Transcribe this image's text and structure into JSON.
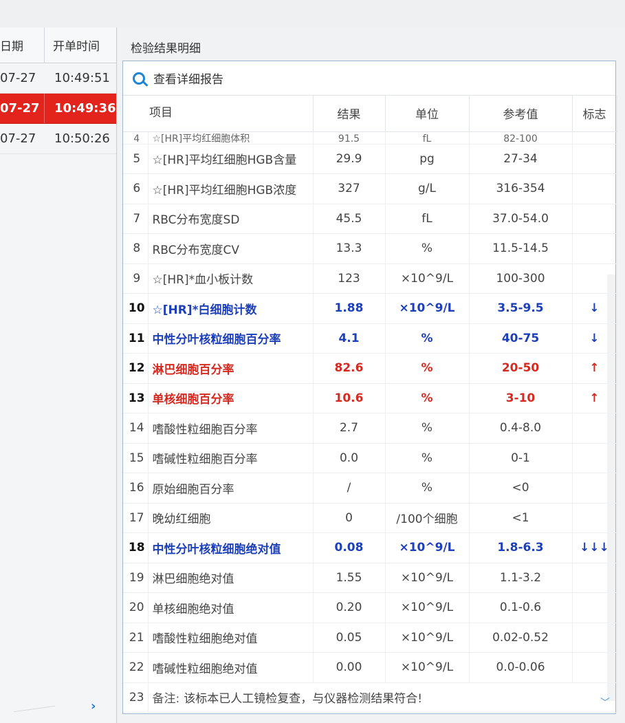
{
  "left_panel": {
    "columns": [
      "日期",
      "开单时间"
    ],
    "rows": [
      {
        "date": "07-27",
        "time": "10:49:51",
        "selected": false
      },
      {
        "date": "07-27",
        "time": "10:49:36",
        "selected": true
      },
      {
        "date": "07-27",
        "time": "10:50:26",
        "selected": false
      }
    ]
  },
  "main_panel": {
    "title": "检验结果明细",
    "toolbar_label": "查看详细报告"
  },
  "table": {
    "headers": {
      "item": "项目",
      "result": "结果",
      "unit": "单位",
      "ref": "参考值",
      "flag": "标志"
    },
    "partial_row": {
      "no": "4",
      "item": "☆[HR]平均红细胞体积",
      "result": "91.5",
      "unit": "fL",
      "ref": "82-100",
      "flag": ""
    },
    "rows": [
      {
        "no": "5",
        "item": "☆[HR]平均红细胞HGB含量",
        "result": "29.9",
        "unit": "pg",
        "ref": "27-34",
        "flag": "",
        "status": "normal"
      },
      {
        "no": "6",
        "item": "☆[HR]平均红细胞HGB浓度",
        "result": "327",
        "unit": "g/L",
        "ref": "316-354",
        "flag": "",
        "status": "normal"
      },
      {
        "no": "7",
        "item": "RBC分布宽度SD",
        "result": "45.5",
        "unit": "fL",
        "ref": "37.0-54.0",
        "flag": "",
        "status": "normal"
      },
      {
        "no": "8",
        "item": "RBC分布宽度CV",
        "result": "13.3",
        "unit": "%",
        "ref": "11.5-14.5",
        "flag": "",
        "status": "normal"
      },
      {
        "no": "9",
        "item": "☆[HR]*血小板计数",
        "result": "123",
        "unit": "×10^9/L",
        "ref": "100-300",
        "flag": "",
        "status": "normal"
      },
      {
        "no": "10",
        "item": "☆[HR]*白细胞计数",
        "result": "1.88",
        "unit": "×10^9/L",
        "ref": "3.5-9.5",
        "flag": "↓",
        "status": "low"
      },
      {
        "no": "11",
        "item": "中性分叶核粒细胞百分率",
        "result": "4.1",
        "unit": "%",
        "ref": "40-75",
        "flag": "↓",
        "status": "low"
      },
      {
        "no": "12",
        "item": "淋巴细胞百分率",
        "result": "82.6",
        "unit": "%",
        "ref": "20-50",
        "flag": "↑",
        "status": "high"
      },
      {
        "no": "13",
        "item": "单核细胞百分率",
        "result": "10.6",
        "unit": "%",
        "ref": "3-10",
        "flag": "↑",
        "status": "high"
      },
      {
        "no": "14",
        "item": "嗜酸性粒细胞百分率",
        "result": "2.7",
        "unit": "%",
        "ref": "0.4-8.0",
        "flag": "",
        "status": "normal"
      },
      {
        "no": "15",
        "item": "嗜碱性粒细胞百分率",
        "result": "0.0",
        "unit": "%",
        "ref": "0-1",
        "flag": "",
        "status": "normal"
      },
      {
        "no": "16",
        "item": "原始细胞百分率",
        "result": "/",
        "unit": "%",
        "ref": "<0",
        "flag": "",
        "status": "normal"
      },
      {
        "no": "17",
        "item": "晚幼红细胞",
        "result": "0",
        "unit": "/100个细胞",
        "ref": "<1",
        "flag": "",
        "status": "normal"
      },
      {
        "no": "18",
        "item": "中性分叶核粒细胞绝对值",
        "result": "0.08",
        "unit": "×10^9/L",
        "ref": "1.8-6.3",
        "flag": "↓↓↓",
        "status": "low"
      },
      {
        "no": "19",
        "item": "淋巴细胞绝对值",
        "result": "1.55",
        "unit": "×10^9/L",
        "ref": "1.1-3.2",
        "flag": "",
        "status": "normal"
      },
      {
        "no": "20",
        "item": "单核细胞绝对值",
        "result": "0.20",
        "unit": "×10^9/L",
        "ref": "0.1-0.6",
        "flag": "",
        "status": "normal"
      },
      {
        "no": "21",
        "item": "嗜酸性粒细胞绝对值",
        "result": "0.05",
        "unit": "×10^9/L",
        "ref": "0.02-0.52",
        "flag": "",
        "status": "normal"
      },
      {
        "no": "22",
        "item": "嗜碱性粒细胞绝对值",
        "result": "0.00",
        "unit": "×10^9/L",
        "ref": "0.0-0.06",
        "flag": "",
        "status": "normal"
      }
    ],
    "remark_row": {
      "no": "23",
      "label": "备注:",
      "text": "该标本已人工镜检复查，与仪器检测结果符合!"
    }
  },
  "icons": {
    "search": "search-icon",
    "expand": "chevron-right-icon",
    "scroll_down": "chevron-down-icon"
  },
  "colors": {
    "selected_row": "#e2241d",
    "low_value": "#1d3fb8",
    "high_value": "#d42a22",
    "search_icon": "#1d84d6"
  }
}
